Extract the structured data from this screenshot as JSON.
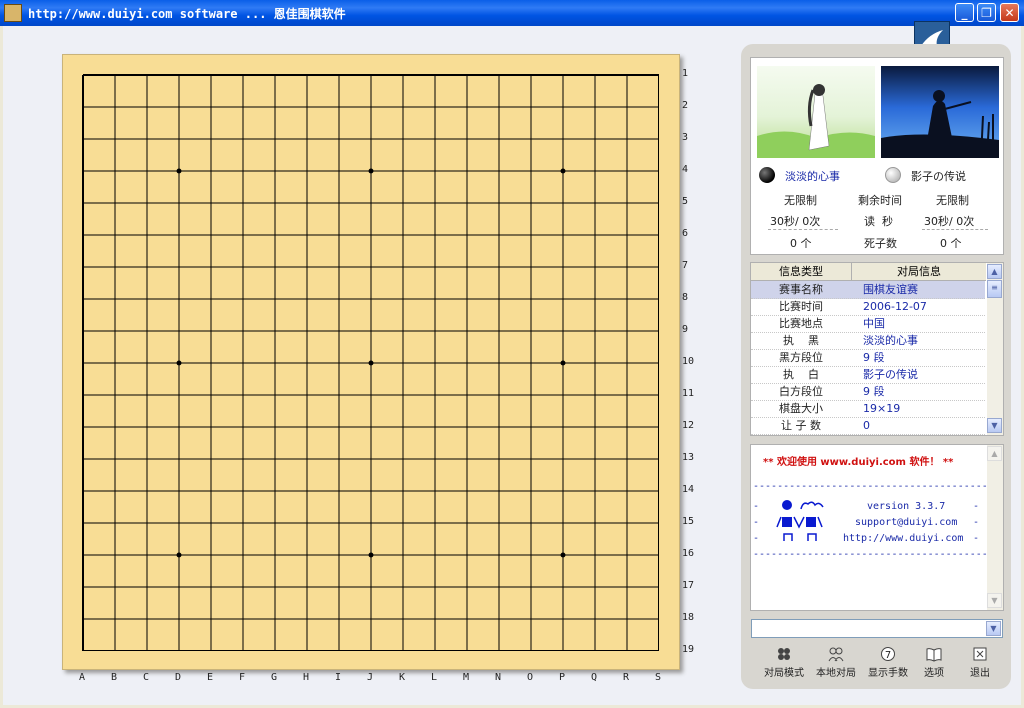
{
  "window": {
    "title": "http://www.duiyi.com software ...  恩佳围棋软件",
    "minimize_label": "_",
    "restore_label": "❐",
    "close_label": "✕"
  },
  "board": {
    "size": 19,
    "col_labels": [
      "A",
      "B",
      "C",
      "D",
      "E",
      "F",
      "G",
      "H",
      "I",
      "J",
      "K",
      "L",
      "M",
      "N",
      "O",
      "P",
      "Q",
      "R",
      "S"
    ],
    "row_labels": [
      "1",
      "2",
      "3",
      "4",
      "5",
      "6",
      "7",
      "8",
      "9",
      "10",
      "11",
      "12",
      "13",
      "14",
      "15",
      "16",
      "17",
      "18",
      "19"
    ],
    "star_points": [
      [
        3,
        3
      ],
      [
        9,
        3
      ],
      [
        15,
        3
      ],
      [
        3,
        9
      ],
      [
        9,
        9
      ],
      [
        15,
        9
      ],
      [
        3,
        15
      ],
      [
        9,
        15
      ],
      [
        15,
        15
      ]
    ]
  },
  "players": {
    "black": {
      "name": "淡淡的心事",
      "time": "无限制",
      "byoyomi": "30秒/ 0次",
      "captured": "0 个"
    },
    "white": {
      "name": "影子の传说",
      "time": "无限制",
      "byoyomi": "30秒/ 0次",
      "captured": "0 个"
    },
    "remaining_time_label": "剩余时间",
    "byoyomi_label": "读  秒",
    "captured_label": "死子数"
  },
  "info_table": {
    "headers": [
      "信息类型",
      "对局信息"
    ],
    "rows": [
      {
        "k": "赛事名称",
        "v": "围棋友谊赛"
      },
      {
        "k": "比赛时间",
        "v": "2006-12-07"
      },
      {
        "k": "比赛地点",
        "v": "中国"
      },
      {
        "k": "执    黑",
        "v": "淡淡的心事"
      },
      {
        "k": "黑方段位",
        "v": "9 段"
      },
      {
        "k": "执    白",
        "v": "影子の传说"
      },
      {
        "k": "白方段位",
        "v": "9 段"
      },
      {
        "k": "棋盘大小",
        "v": "19×19"
      },
      {
        "k": "让 子 数",
        "v": "0"
      }
    ]
  },
  "messages": {
    "welcome": "** 欢迎使用 www.duiyi.com 软件！ **",
    "version": "version 3.3.7",
    "email": "support@duiyi.com",
    "url": "http://www.duiyi.com"
  },
  "toolbar": [
    {
      "label": "对局模式",
      "icon": "players-icon"
    },
    {
      "label": "本地对局",
      "icon": "local-game-icon"
    },
    {
      "label": "显示手数",
      "icon": "move-number-icon"
    },
    {
      "label": "选项",
      "icon": "book-icon"
    },
    {
      "label": "退出",
      "icon": "exit-icon"
    }
  ],
  "colors": {
    "board": "#f8dd95",
    "titlebar": "#0054e3",
    "accent_text": "#1a2aa8",
    "welcome_text": "#d01010"
  }
}
